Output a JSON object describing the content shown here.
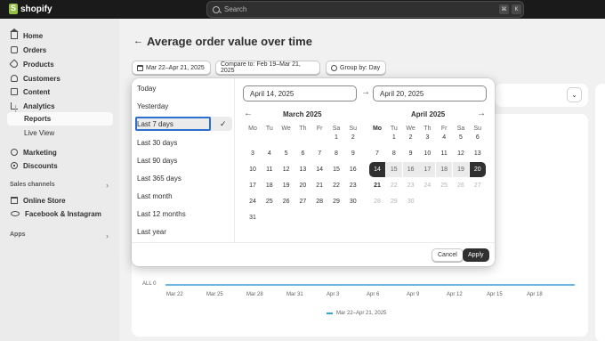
{
  "topbar": {
    "brand": "shopify",
    "search_placeholder": "Search",
    "shortcut_keys": [
      "⌘",
      "K"
    ]
  },
  "sidebar": {
    "items": [
      {
        "label": "Home",
        "icon": "home-icon"
      },
      {
        "label": "Orders",
        "icon": "orders-icon"
      },
      {
        "label": "Products",
        "icon": "tag-icon"
      },
      {
        "label": "Customers",
        "icon": "person-icon"
      },
      {
        "label": "Content",
        "icon": "content-icon"
      },
      {
        "label": "Analytics",
        "icon": "analytics-icon"
      }
    ],
    "sub_items": [
      {
        "label": "Reports"
      },
      {
        "label": "Live View"
      }
    ],
    "items2": [
      {
        "label": "Marketing",
        "icon": "target-icon"
      },
      {
        "label": "Discounts",
        "icon": "discount-icon"
      }
    ],
    "sales_channels_label": "Sales channels",
    "channels": [
      {
        "label": "Online Store",
        "icon": "store-icon"
      },
      {
        "label": "Facebook & Instagram",
        "icon": "meta-icon"
      }
    ],
    "apps_label": "Apps"
  },
  "main": {
    "title": "Average order value over time",
    "date_chip": "Mar 22–Apr 21, 2025",
    "compare_chip": "Compare to: Feb 19–Mar 21, 2025",
    "group_chip": "Group by: Day"
  },
  "popover": {
    "presets": [
      "Today",
      "Yesterday",
      "Last 7 days",
      "Last 30 days",
      "Last 90 days",
      "Last 365 days",
      "Last month",
      "Last 12 months",
      "Last year"
    ],
    "selected_preset": "Last 7 days",
    "start_date": "April 14, 2025",
    "end_date": "April 20, 2025",
    "weekdays": [
      "Mo",
      "Tu",
      "We",
      "Th",
      "Fr",
      "Sa",
      "Su"
    ],
    "months": [
      {
        "label": "March 2025",
        "weeks": [
          [
            "",
            "",
            "",
            "",
            "",
            "1",
            "2"
          ],
          [
            "3",
            "4",
            "5",
            "6",
            "7",
            "8",
            "9"
          ],
          [
            "10",
            "11",
            "12",
            "13",
            "14",
            "15",
            "16"
          ],
          [
            "17",
            "18",
            "19",
            "20",
            "21",
            "22",
            "23"
          ],
          [
            "24",
            "25",
            "26",
            "27",
            "28",
            "29",
            "30"
          ],
          [
            "31",
            "",
            "",
            "",
            "",
            "",
            ""
          ]
        ]
      },
      {
        "label": "April 2025",
        "weeks": [
          [
            "",
            "1",
            "2",
            "3",
            "4",
            "5",
            "6"
          ],
          [
            "7",
            "8",
            "9",
            "10",
            "11",
            "12",
            "13"
          ],
          [
            "14",
            "15",
            "16",
            "17",
            "18",
            "19",
            "20"
          ],
          [
            "21",
            "22",
            "23",
            "24",
            "25",
            "26",
            "27"
          ],
          [
            "28",
            "29",
            "30",
            "",
            "",
            "",
            ""
          ]
        ]
      }
    ],
    "cancel_label": "Cancel",
    "apply_label": "Apply"
  },
  "chart": {
    "y_zero_label": "ALL 0",
    "x_ticks": [
      "Mar 22",
      "Mar 25",
      "Mar 28",
      "Mar 31",
      "Apr 3",
      "Apr 6",
      "Apr 9",
      "Apr 12",
      "Apr 15",
      "Apr 18"
    ],
    "legend": "Mar 22–Apr 21, 2025",
    "line_color": "#3aa0d8"
  }
}
